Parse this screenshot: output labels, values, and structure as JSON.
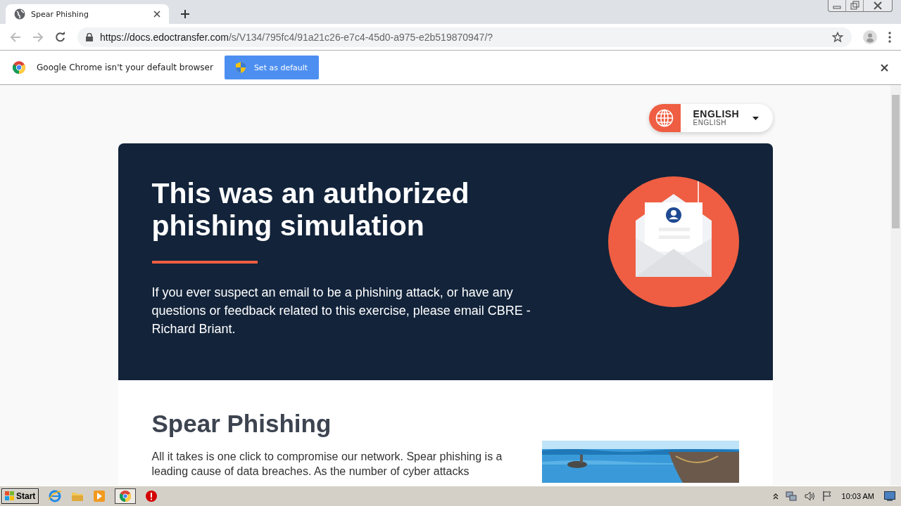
{
  "browser": {
    "tab": {
      "title": "Spear Phishing"
    },
    "address": {
      "host": "https://docs.edoctransfer.com",
      "path": "/s/V134/795fc4/91a21c26-e7c4-45d0-a975-e2b519870947/?"
    }
  },
  "infobar": {
    "message": "Google Chrome isn't your default browser",
    "button": "Set as default"
  },
  "language": {
    "label": "ENGLISH",
    "sublabel": "ENGLISH"
  },
  "hero": {
    "title": "This was an authorized phishing simulation",
    "text": "If you ever suspect an email to be a phishing attack, or have any questions or feedback related to this exercise, please email CBRE - Richard Briant."
  },
  "section": {
    "heading": "Spear Phishing",
    "text": "All it takes is one click to compromise our network. Spear phishing is a leading cause of data breaches. As the number of cyber attacks"
  },
  "taskbar": {
    "start": "Start",
    "clock": "10:03 AM"
  }
}
